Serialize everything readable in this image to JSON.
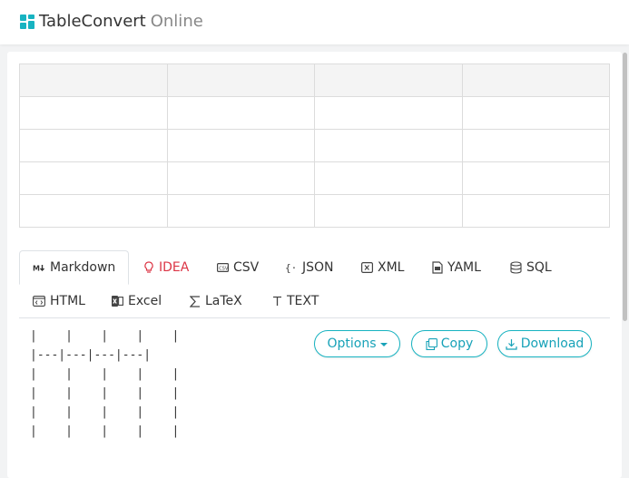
{
  "app": {
    "brand_main": "TableConvert",
    "brand_suffix": "Online",
    "logo_color": "#17b3c1"
  },
  "grid": {
    "rows": 5,
    "cols": 4,
    "header_bg": "#f4f4f4"
  },
  "tabs": [
    {
      "label": "Markdown",
      "icon": "markdown-icon",
      "active": true
    },
    {
      "label": "IDEA",
      "icon": "lightbulb-icon",
      "active": false,
      "color": "#dc3545"
    },
    {
      "label": "CSV",
      "icon": "csv-icon",
      "active": false
    },
    {
      "label": "JSON",
      "icon": "json-braces-icon",
      "active": false
    },
    {
      "label": "XML",
      "icon": "xml-icon",
      "active": false
    },
    {
      "label": "YAML",
      "icon": "yaml-file-icon",
      "active": false
    },
    {
      "label": "SQL",
      "icon": "database-icon",
      "active": false
    },
    {
      "label": "HTML",
      "icon": "html-icon",
      "active": false
    },
    {
      "label": "Excel",
      "icon": "excel-icon",
      "active": false
    },
    {
      "label": "LaTeX",
      "icon": "sigma-icon",
      "active": false
    },
    {
      "label": "TEXT",
      "icon": "text-t-icon",
      "active": false
    }
  ],
  "output": {
    "text": "|    |    |    |    |\n|---|---|---|---|\n|    |    |    |    |\n|    |    |    |    |\n|    |    |    |    |\n|    |    |    |    |"
  },
  "actions": {
    "options_label": "Options",
    "copy_label": "Copy",
    "download_label": "Download",
    "accent": "#17a2b8"
  }
}
